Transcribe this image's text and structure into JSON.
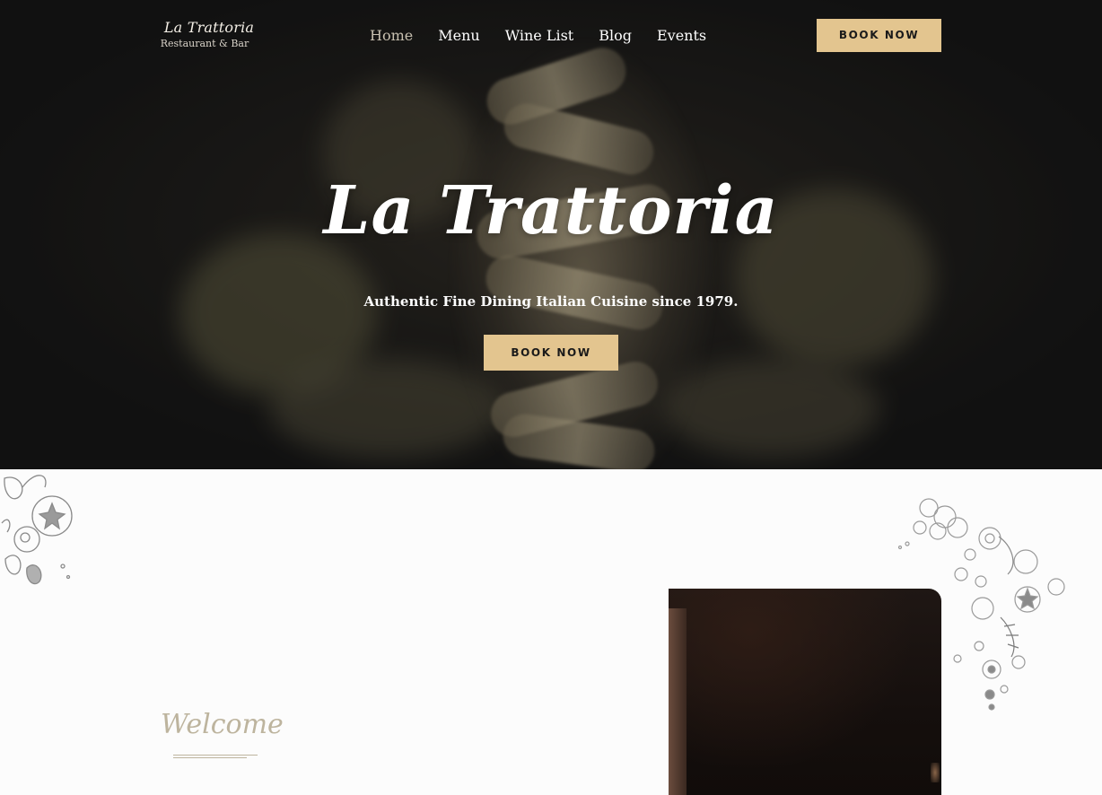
{
  "brand": {
    "logo_script": "La Trattoria",
    "logo_sub": "Restaurant & Bar"
  },
  "nav": {
    "items": [
      {
        "label": "Home",
        "active": true
      },
      {
        "label": "Menu",
        "active": false
      },
      {
        "label": "Wine List",
        "active": false
      },
      {
        "label": "Blog",
        "active": false
      },
      {
        "label": "Events",
        "active": false
      }
    ]
  },
  "header": {
    "cta_label": "BOOK NOW"
  },
  "hero": {
    "title": "La Trattoria",
    "tagline": "Authentic Fine Dining Italian Cuisine since 1979.",
    "cta_label": "BOOK NOW"
  },
  "about": {
    "eyebrow": "Welcome"
  },
  "colors": {
    "accent": "#e3c58f",
    "hero_bg": "#161616",
    "eyebrow": "#bdb49e",
    "page_bg": "#fcfcfc"
  },
  "icons": {
    "left_decoration": "vegetable-sketch-icon",
    "right_decoration": "vegetable-sketch-icon"
  }
}
